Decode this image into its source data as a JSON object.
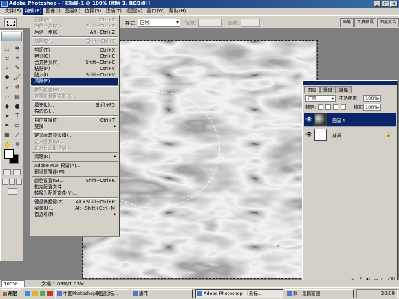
{
  "app": {
    "title": "Adobe Photoshop - [未标题-1 @ 100% (图层 1, RGB/8)]",
    "window_buttons": [
      "_",
      "□",
      "×"
    ]
  },
  "menubar": [
    "文件(F)",
    "编辑(E)",
    "图像(I)",
    "图层(L)",
    "选择(S)",
    "滤镜(T)",
    "视图(V)",
    "窗口(W)",
    "帮助(H)"
  ],
  "options": {
    "style_label": "样式:",
    "style_value": "正常",
    "width_label": "宽度:",
    "height_label": "高度:",
    "palette_tabs": [
      "画笔",
      "工具预设",
      "图层复合"
    ]
  },
  "edit_menu": [
    {
      "label": "还原(O)",
      "shortcut": "Ctrl+Z",
      "disabled": true
    },
    {
      "label": "向前一步(W)",
      "shortcut": "Shift+Ctrl+Z",
      "disabled": true
    },
    {
      "label": "后退一步(K)",
      "shortcut": "Alt+Ctrl+Z"
    },
    {
      "sep": true
    },
    {
      "label": "渐隐(D)...",
      "shortcut": "Shift+Ctrl+F",
      "disabled": true
    },
    {
      "sep": true
    },
    {
      "label": "剪切(T)",
      "shortcut": "Ctrl+X"
    },
    {
      "label": "拷贝(C)",
      "shortcut": "Ctrl+C"
    },
    {
      "label": "合并拷贝(Y)",
      "shortcut": "Shift+Ctrl+C"
    },
    {
      "label": "粘贴(P)",
      "shortcut": "Ctrl+V"
    },
    {
      "label": "贴入(I)",
      "shortcut": "Shift+Ctrl+V"
    },
    {
      "label": "清除(E)",
      "highlighted": true
    },
    {
      "sep": true
    },
    {
      "label": "拼写检查(H)...",
      "disabled": true
    },
    {
      "label": "查找和替换文本(X)...",
      "disabled": true
    },
    {
      "sep": true
    },
    {
      "label": "填充(L)...",
      "shortcut": "Shift+F5"
    },
    {
      "label": "描边(S)..."
    },
    {
      "sep": true
    },
    {
      "label": "自由变换(F)",
      "shortcut": "Ctrl+T"
    },
    {
      "label": "变换",
      "submenu": true
    },
    {
      "sep": true
    },
    {
      "label": "定义画笔预设(B)..."
    },
    {
      "label": "定义图案(Q)...",
      "disabled": true
    },
    {
      "label": "定义自定形状(J)...",
      "disabled": true
    },
    {
      "sep": true
    },
    {
      "label": "清理(R)",
      "submenu": true
    },
    {
      "sep": true
    },
    {
      "label": "Adobe PDF 预设(A)..."
    },
    {
      "label": "预设管理器(M)..."
    },
    {
      "sep": true
    },
    {
      "label": "颜色设置(G)...",
      "shortcut": "Shift+Ctrl+K"
    },
    {
      "label": "指定配置文件..."
    },
    {
      "label": "转换为配置文件(V)..."
    },
    {
      "sep": true
    },
    {
      "label": "键盘快捷键(Z)...",
      "shortcut": "Alt+Shift+Ctrl+K"
    },
    {
      "label": "菜单(U)...",
      "shortcut": "Alt+Shift+Ctrl+M"
    },
    {
      "label": "首选项(N)",
      "submenu": true
    }
  ],
  "layers_panel": {
    "tabs": [
      "图层",
      "通道",
      "路径"
    ],
    "blend_mode": "正常",
    "opacity_label": "不透明度:",
    "opacity_value": "100%",
    "lock_label": "锁定:",
    "fill_label": "填充:",
    "fill_value": "100%",
    "layers": [
      {
        "name": "图层 1",
        "selected": true
      },
      {
        "name": "背景",
        "selected": false,
        "locked": true
      }
    ],
    "bottom_buttons": [
      "∞",
      "ƒ",
      "◐",
      "▭",
      "▢",
      "⌫"
    ]
  },
  "status": {
    "zoom": "100%",
    "doc_info": "文档:1.03M/1.03M"
  },
  "taskbar": {
    "start_label": "开始",
    "tasks": [
      {
        "label": "中国Photoshop联盟论坛...",
        "active": false
      },
      {
        "label": "唐伟",
        "active": false
      },
      {
        "label": "Adobe Photoshop - [未标...",
        "active": true
      },
      {
        "label": "群 - 觅麟家园",
        "active": false
      }
    ],
    "clock": "20:09"
  },
  "colors": {
    "menu_highlight": "#0a246a",
    "chrome": "#d4d0c8",
    "titlebar": "#0a246a"
  }
}
